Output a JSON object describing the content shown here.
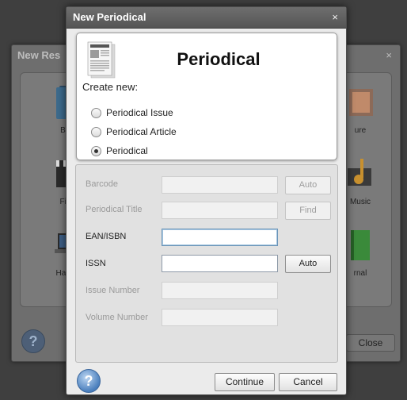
{
  "background_window": {
    "title": "New Res",
    "close_glyph": "×",
    "items": [
      {
        "label": "Boo",
        "icon": "book-icon"
      },
      {
        "label": "ure",
        "icon": "picture-icon"
      },
      {
        "label": "Film",
        "icon": "film-clapper-icon"
      },
      {
        "label": "Music",
        "icon": "music-note-icon"
      },
      {
        "label": "Hardw",
        "icon": "laptop-icon"
      },
      {
        "label": "rnal",
        "icon": "journal-icon"
      }
    ],
    "help_glyph": "?",
    "close_button_label": "Close"
  },
  "dialog": {
    "title": "New Periodical",
    "close_glyph": "×",
    "header_title": "Periodical",
    "icon": "newspaper-icon",
    "create_new_label": "Create new:",
    "options": [
      {
        "label": "Periodical Issue",
        "checked": false
      },
      {
        "label": "Periodical Article",
        "checked": false
      },
      {
        "label": "Periodical",
        "checked": true
      }
    ],
    "fields": {
      "barcode": {
        "label": "Barcode",
        "value": "",
        "button": "Auto"
      },
      "periodical_title": {
        "label": "Periodical Title",
        "value": "",
        "button": "Find"
      },
      "ean_isbn": {
        "label": "EAN/ISBN",
        "value": ""
      },
      "issn": {
        "label": "ISSN",
        "value": "",
        "button": "Auto"
      },
      "issue_number": {
        "label": "Issue Number",
        "value": ""
      },
      "volume_number": {
        "label": "Volume Number",
        "value": ""
      }
    },
    "help_glyph": "?",
    "continue_label": "Continue",
    "cancel_label": "Cancel"
  }
}
